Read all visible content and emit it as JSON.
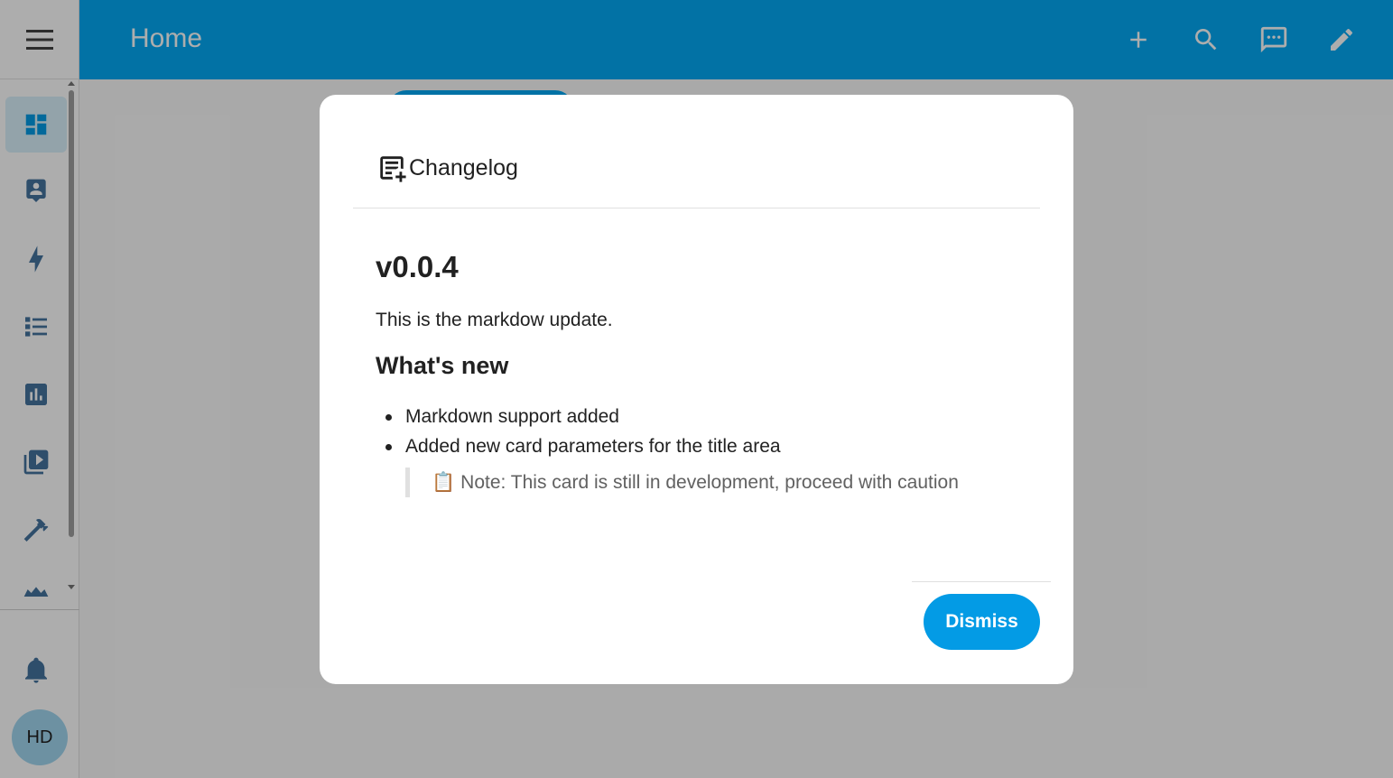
{
  "header": {
    "title": "Home",
    "actions": [
      "plus-icon",
      "search-icon",
      "assist-icon",
      "pencil-icon"
    ]
  },
  "sidebar": {
    "items": [
      {
        "icon": "dashboard-icon",
        "active": true
      },
      {
        "icon": "account-box-icon"
      },
      {
        "icon": "lightning-icon"
      },
      {
        "icon": "list-icon"
      },
      {
        "icon": "chart-icon"
      },
      {
        "icon": "media-icon"
      },
      {
        "icon": "hammer-icon"
      },
      {
        "icon": "hacs-icon"
      }
    ],
    "notifications_icon": "bell-icon",
    "user_initials": "HD"
  },
  "dialog": {
    "title": "Changelog",
    "version": "v0.0.4",
    "intro": "This is the markdow update.",
    "section_heading": "What's new",
    "changes": [
      "Markdown support added",
      "Added new card parameters for the title area"
    ],
    "note_emoji": "📋",
    "note": "Note: This card is still in development, proceed with caution",
    "dismiss_label": "Dismiss"
  },
  "colors": {
    "header": "#03a9f4",
    "primary": "#039be5",
    "avatar": "#a1d6ef",
    "sidebar_icon": "#44739e"
  }
}
